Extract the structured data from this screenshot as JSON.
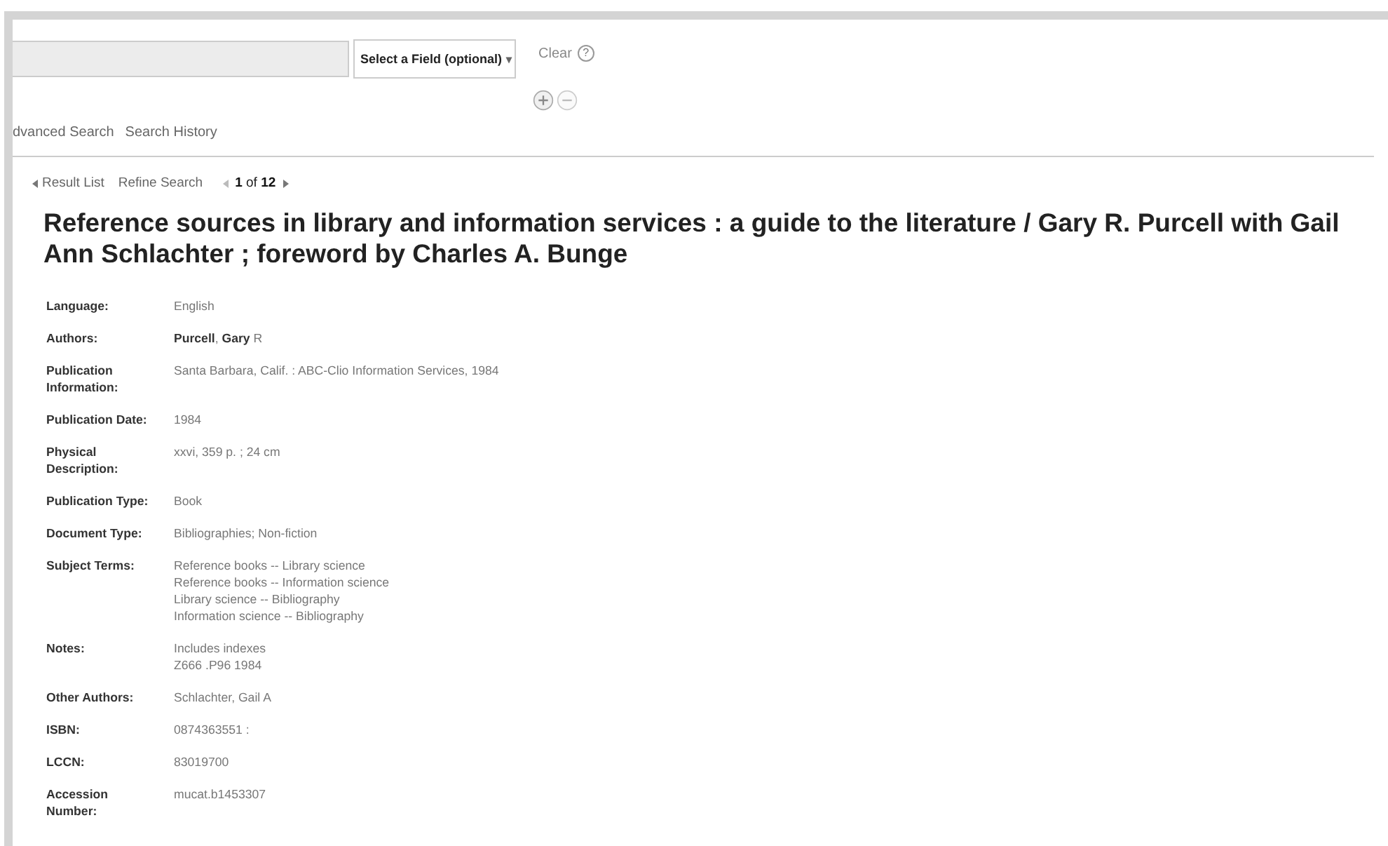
{
  "search": {
    "field_button": "Select a Field (optional)",
    "caret": "▾",
    "clear": "Clear",
    "help": "?"
  },
  "links": [
    "dvanced Search",
    "Search History"
  ],
  "nav": {
    "back": "Result List",
    "refine": "Refine Search",
    "position": "**1** of **12**"
  },
  "title": "Reference sources in library and information services : a guide to the literature / Gary R. Purcell with Gail Ann Schlachter ; foreword by Charles A. Bunge",
  "fields": [
    {
      "label": "Language:",
      "lines": [
        "English"
      ]
    },
    {
      "label": "Authors:",
      "lines": [
        "**Purcell**, **Gary** R"
      ]
    },
    {
      "label": "Publication Information:",
      "lines": [
        "Santa Barbara, Calif. : ABC-Clio Information Services, 1984"
      ]
    },
    {
      "label": "Publication Date:",
      "lines": [
        "1984"
      ]
    },
    {
      "label": "Physical Description:",
      "lines": [
        "xxvi, 359 p. ; 24 cm"
      ]
    },
    {
      "label": "Publication Type:",
      "lines": [
        "Book"
      ]
    },
    {
      "label": "Document Type:",
      "lines": [
        "Bibliographies; Non-fiction"
      ]
    },
    {
      "label": "Subject Terms:",
      "lines": [
        "Reference books -- Library science",
        "Reference books -- Information science",
        "Library science -- Bibliography",
        "Information science -- Bibliography"
      ]
    },
    {
      "label": "Notes:",
      "lines": [
        "Includes indexes",
        "Z666 .P96 1984"
      ]
    },
    {
      "label": "Other Authors:",
      "lines": [
        "Schlachter, Gail A"
      ]
    },
    {
      "label": "ISBN:",
      "lines": [
        "0874363551 :"
      ]
    },
    {
      "label": "LCCN:",
      "lines": [
        "83019700"
      ]
    },
    {
      "label": "Accession Number:",
      "lines": [
        "mucat.b1453307"
      ]
    }
  ]
}
